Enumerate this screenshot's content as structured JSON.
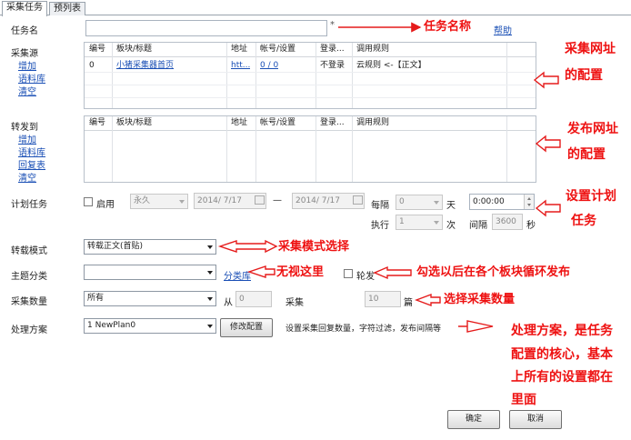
{
  "tabs": [
    "采集任务",
    "预列表"
  ],
  "task_name": {
    "label": "任务名",
    "value": "",
    "required_mark": "*",
    "help": "帮助",
    "note": "任务名称"
  },
  "source": {
    "label": "采集源",
    "actions": [
      "增加",
      "语料库",
      "清空"
    ],
    "columns": [
      "编号",
      "板块/标题",
      "地址",
      "帐号/设置",
      "登录...",
      "调用规则"
    ],
    "rows": [
      [
        "0",
        "小猪采集器首页",
        "htt...",
        "0 / 0",
        "不登录",
        "云规则 <-【正文】"
      ]
    ],
    "note": [
      "采集网址",
      "的配置"
    ]
  },
  "publish": {
    "label": "转发到",
    "actions": [
      "增加",
      "语料库",
      "回复表",
      "清空"
    ],
    "columns": [
      "编号",
      "板块/标题",
      "地址",
      "帐号/设置",
      "登录...",
      "调用规则"
    ],
    "note": [
      "发布网址",
      "的配置"
    ]
  },
  "schedule": {
    "label": "计划任务",
    "enable_label": "启用",
    "mode": "永久",
    "date_start": "2014/ 7/17",
    "dash": "—",
    "date_end": "2014/ 7/17",
    "every_label": "每隔",
    "every_value": "0",
    "day_unit": "天",
    "time_value": "0:00:00",
    "exec_label": "执行",
    "exec_value": "1",
    "times_unit": "次",
    "interval_label": "间隔",
    "interval_value": "3600",
    "seconds_unit": "秒",
    "note": [
      "设置计划",
      "任务"
    ]
  },
  "reprint": {
    "label": "转载模式",
    "value": "转载正文(首贴)",
    "note": "采集模式选择"
  },
  "topic": {
    "label": "主题分类",
    "value": "",
    "category_link": "分类库",
    "rotate_label": "轮发",
    "note1": "无视这里",
    "note2": "勾选以后在各个板块循环发布"
  },
  "count": {
    "label": "采集数量",
    "value": "所有",
    "from_label": "从",
    "from_value": "0",
    "collect_label": "采集",
    "collect_value": "10",
    "unit": "篇",
    "note": "选择采集数量"
  },
  "plan": {
    "label": "处理方案",
    "value": "1 NewPlan0",
    "edit_button": "修改配置",
    "desc": "设置采集回复数量，字符过滤，发布间隔等",
    "note": [
      "处理方案，是任务",
      "配置的核心，基本",
      "上所有的设置都在",
      "里面"
    ]
  },
  "footer": {
    "ok": "确定",
    "cancel": "取消"
  },
  "colors": {
    "annotation": "#ee1111",
    "link": "#1a4fb5"
  }
}
